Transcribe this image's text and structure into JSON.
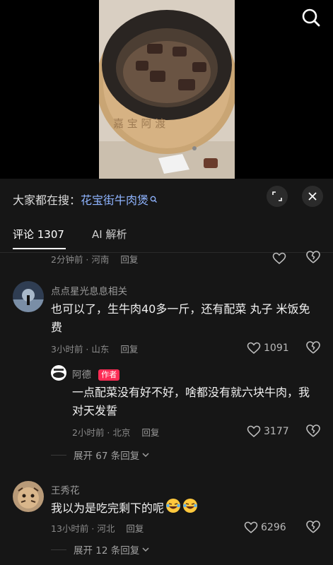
{
  "search": {
    "icon": "search-icon"
  },
  "suggest": {
    "prefix": "大家都在搜：",
    "keyword": "花宝街牛肉煲"
  },
  "tabs": [
    {
      "label": "评论 1307",
      "active": true
    },
    {
      "label": "AI 解析",
      "active": false
    }
  ],
  "comments": [
    {
      "meta_time": "2分钟前 · 河南",
      "reply_label": "回复"
    },
    {
      "username": "点点星光息息相关",
      "text": "也可以了，生牛肉40多一斤，还有配菜 丸子 米饭免费",
      "meta_time": "3小时前 · 山东",
      "reply_label": "回复",
      "likes": "1091",
      "reply": {
        "username": "阿德",
        "badge": "作者",
        "text": "一点配菜没有好不好，啥都没有就六块牛肉，我对天发誓",
        "meta_time": "2小时前 · 北京",
        "reply_label": "回复",
        "likes": "3177"
      },
      "expand_label": "展开 67 条回复"
    },
    {
      "username": "王秀花",
      "text": "我以为是吃完剩下的呢",
      "meta_time": "13小时前 · 河北",
      "reply_label": "回复",
      "likes": "6296",
      "expand_label": "展开 12 条回复"
    }
  ],
  "colors": {
    "sheet_bg": "#161616",
    "accent_link": "#8fb4ff",
    "author_badge": "#fe2c55"
  }
}
